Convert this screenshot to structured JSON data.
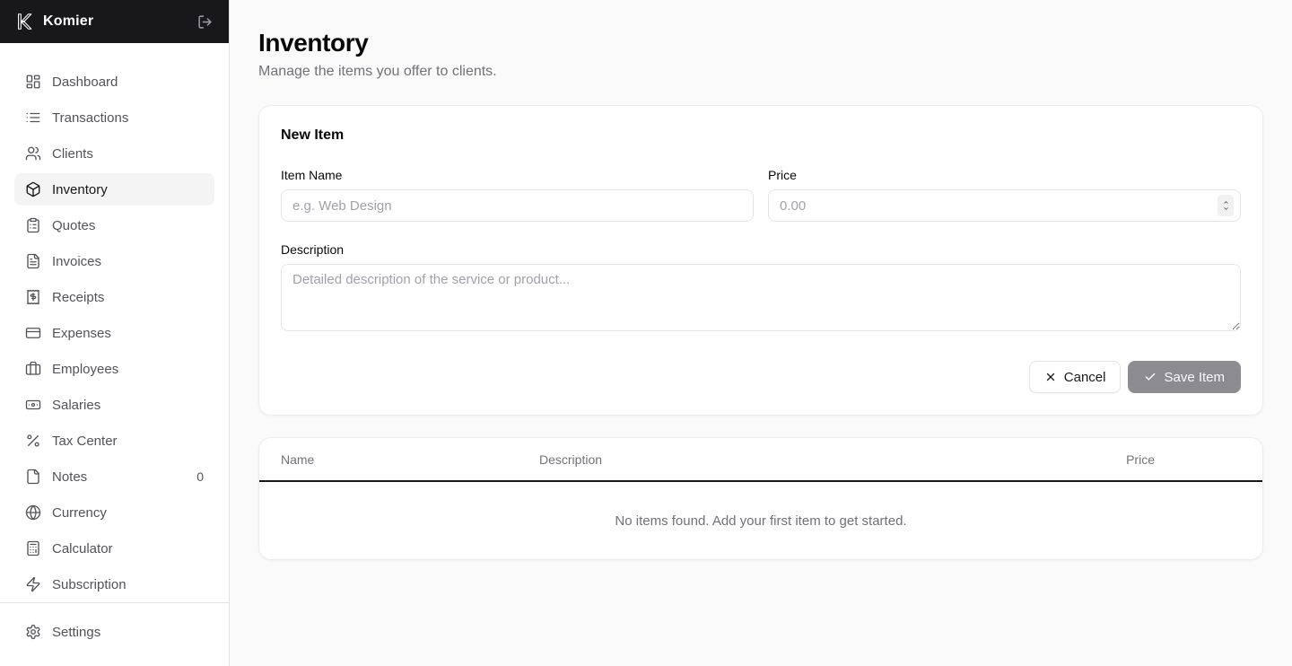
{
  "app": {
    "name": "Komier"
  },
  "sidebar": {
    "items": [
      {
        "label": "Dashboard",
        "icon": "dashboard-icon",
        "active": false
      },
      {
        "label": "Transactions",
        "icon": "transactions-icon",
        "active": false
      },
      {
        "label": "Clients",
        "icon": "clients-icon",
        "active": false
      },
      {
        "label": "Inventory",
        "icon": "inventory-icon",
        "active": true
      },
      {
        "label": "Quotes",
        "icon": "quotes-icon",
        "active": false
      },
      {
        "label": "Invoices",
        "icon": "invoices-icon",
        "active": false
      },
      {
        "label": "Receipts",
        "icon": "receipts-icon",
        "active": false
      },
      {
        "label": "Expenses",
        "icon": "expenses-icon",
        "active": false
      },
      {
        "label": "Employees",
        "icon": "employees-icon",
        "active": false
      },
      {
        "label": "Salaries",
        "icon": "salaries-icon",
        "active": false
      },
      {
        "label": "Tax Center",
        "icon": "tax-center-icon",
        "active": false
      },
      {
        "label": "Notes",
        "icon": "notes-icon",
        "active": false,
        "count": "0"
      },
      {
        "label": "Currency",
        "icon": "currency-icon",
        "active": false
      },
      {
        "label": "Calculator",
        "icon": "calculator-icon",
        "active": false
      },
      {
        "label": "Subscription",
        "icon": "subscription-icon",
        "active": false
      }
    ],
    "settings": {
      "label": "Settings",
      "icon": "settings-icon"
    }
  },
  "page": {
    "title": "Inventory",
    "subtitle": "Manage the items you offer to clients."
  },
  "form": {
    "title": "New Item",
    "fields": {
      "item_name": {
        "label": "Item Name",
        "placeholder": "e.g. Web Design",
        "value": ""
      },
      "price": {
        "label": "Price",
        "placeholder": "0.00",
        "value": ""
      },
      "description": {
        "label": "Description",
        "placeholder": "Detailed description of the service or product...",
        "value": ""
      }
    },
    "buttons": {
      "cancel": "Cancel",
      "save": "Save Item"
    }
  },
  "table": {
    "columns": [
      "Name",
      "Description",
      "Price"
    ],
    "empty_message": "No items found. Add your first item to get started."
  },
  "colors": {
    "sidebar_header_bg": "#18181b",
    "active_item_bg": "#f4f4f5",
    "nav_text": "#52525b",
    "muted_text": "#71717a",
    "save_button_bg": "#8b8b90",
    "table_header_border": "#18181b",
    "card_bg": "#ffffff",
    "page_bg": "#fafafa"
  }
}
